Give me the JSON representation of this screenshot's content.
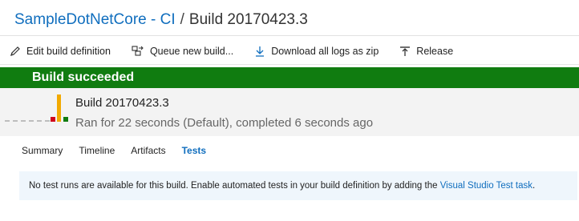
{
  "breadcrumb": {
    "project": "SampleDotNetCore - CI",
    "separator": "/",
    "current": "Build 20170423.3"
  },
  "toolbar": {
    "items": [
      {
        "label": "Edit build definition",
        "icon": "pencil-icon"
      },
      {
        "label": "Queue new build...",
        "icon": "queue-build-icon"
      },
      {
        "label": "Download all logs as zip",
        "icon": "download-icon"
      },
      {
        "label": "Release",
        "icon": "release-icon"
      }
    ]
  },
  "banner": {
    "text": "Build succeeded",
    "color": "#107c10"
  },
  "summary": {
    "title": "Build 20170423.3",
    "subtitle": "Ran for 22 seconds (Default), completed 6 seconds ago",
    "chart_colors": {
      "yellow": "#f2a900",
      "red": "#d0021b",
      "green": "#107c10"
    }
  },
  "tabs": {
    "items": [
      "Summary",
      "Timeline",
      "Artifacts",
      "Tests"
    ],
    "active": "Tests"
  },
  "message": {
    "text": "No test runs are available for this build. Enable automated tests in your build definition by adding the",
    "link_text": "Visual Studio Test task",
    "trailing": "."
  },
  "colors": {
    "accent": "#106ebe",
    "success": "#107c10"
  }
}
